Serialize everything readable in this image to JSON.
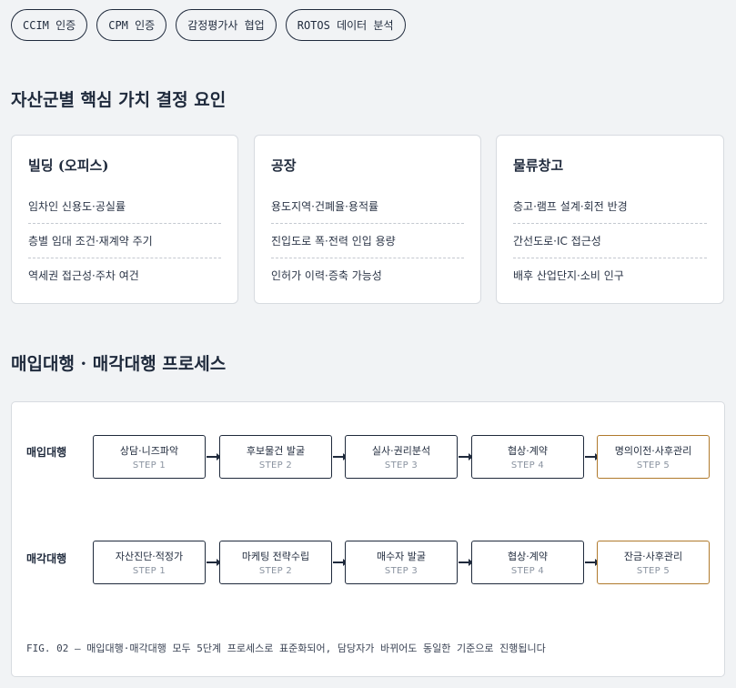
{
  "badges": [
    "CCIM 인증",
    "CPM 인증",
    "감정평가사 협업",
    "ROTOS 데이터 분석"
  ],
  "section1": {
    "title": "자산군별 핵심 가치 결정 요인"
  },
  "cards": [
    {
      "title": "빌딩 (오피스)",
      "items": [
        "임차인 신용도·공실률",
        "층별 임대 조건·재계약 주기",
        "역세권 접근성·주차 여건"
      ]
    },
    {
      "title": "공장",
      "items": [
        "용도지역·건폐율·용적률",
        "진입도로 폭·전력 인입 용량",
        "인허가 이력·증축 가능성"
      ]
    },
    {
      "title": "물류창고",
      "items": [
        "층고·램프 설계·회전 반경",
        "간선도로·IC 접근성",
        "배후 산업단지·소비 인구"
      ]
    }
  ],
  "section2": {
    "title": "매입대행 · 매각대행 프로세스"
  },
  "process": {
    "rows": [
      {
        "label": "매입대행",
        "steps": [
          {
            "name": "상담·니즈파악",
            "step": "STEP 1"
          },
          {
            "name": "후보물건 발굴",
            "step": "STEP 2"
          },
          {
            "name": "실사·권리분석",
            "step": "STEP 3"
          },
          {
            "name": "협상·계약",
            "step": "STEP 4"
          },
          {
            "name": "명의이전·사후관리",
            "step": "STEP 5"
          }
        ]
      },
      {
        "label": "매각대행",
        "steps": [
          {
            "name": "자산진단·적정가",
            "step": "STEP 1"
          },
          {
            "name": "마케팅 전략수립",
            "step": "STEP 2"
          },
          {
            "name": "매수자 발굴",
            "step": "STEP 3"
          },
          {
            "name": "협상·계약",
            "step": "STEP 4"
          },
          {
            "name": "잔금·사후관리",
            "step": "STEP 5"
          }
        ]
      }
    ],
    "caption": "FIG. 02 — 매입대행·매각대행 모두 5단계 프로세스로 표준화되어, 담당자가 바뀌어도 동일한 기준으로 진행됩니다",
    "final_color": "#b07a2c"
  }
}
